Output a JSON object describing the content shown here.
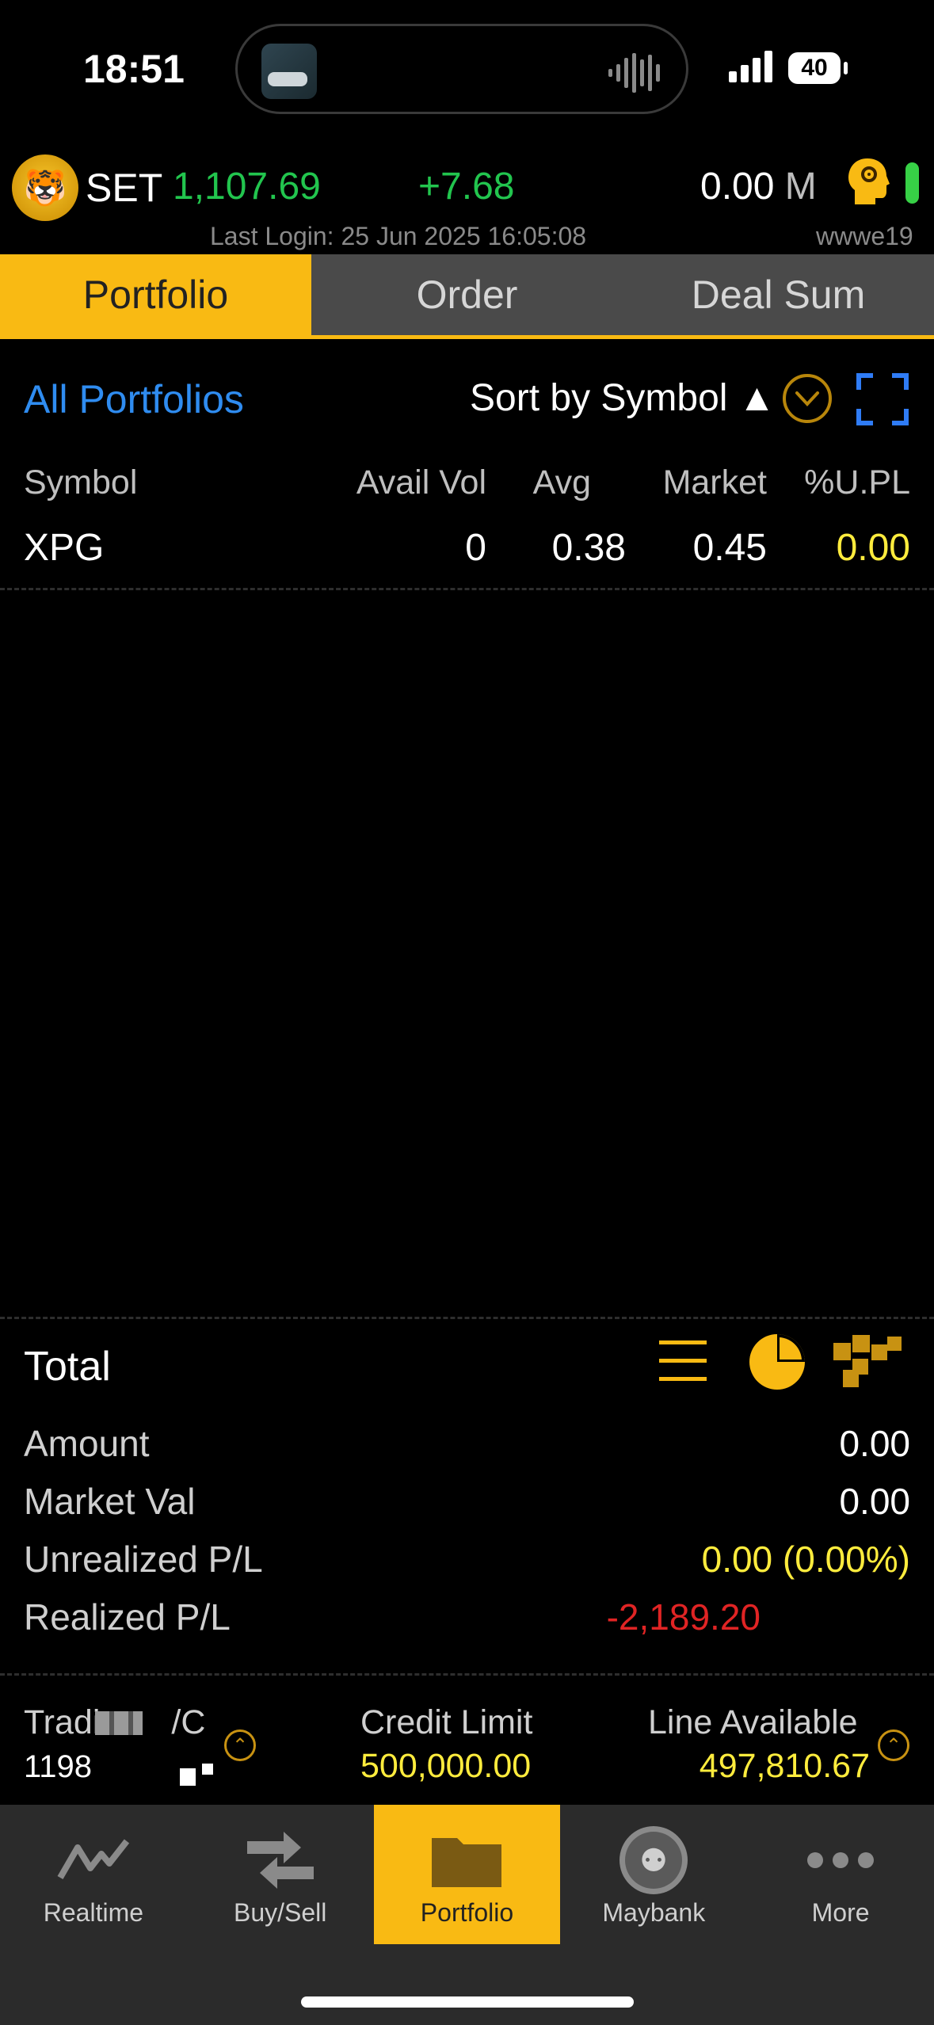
{
  "status_bar": {
    "time": "18:51",
    "battery": "40"
  },
  "market": {
    "name": "SET",
    "index": "1,107.69",
    "change": "+7.68",
    "volume": "0.00",
    "volume_unit": "M",
    "last_login": "Last Login: 25 Jun 2025 16:05:08",
    "user": "wwwe19"
  },
  "tabs": [
    {
      "label": "Portfolio",
      "active": true
    },
    {
      "label": "Order",
      "active": false
    },
    {
      "label": "Deal Sum",
      "active": false
    }
  ],
  "portfolio_bar": {
    "selector": "All Portfolios",
    "sort": "Sort by Symbol ▲"
  },
  "table": {
    "headers": [
      "Symbol",
      "Avail Vol",
      "Avg",
      "Market",
      "%U.PL"
    ],
    "rows": [
      {
        "symbol": "XPG",
        "avail_vol": "0",
        "avg": "0.38",
        "market": "0.45",
        "upl": "0.00"
      }
    ]
  },
  "totals": {
    "title": "Total",
    "rows": [
      {
        "label": "Amount",
        "value": "0.00"
      },
      {
        "label": "Market Val",
        "value": "0.00"
      },
      {
        "label": "Unrealized P/L",
        "value": "0.00 (0.00%)"
      },
      {
        "label": "Realized P/L",
        "value": "-2,189.20"
      }
    ]
  },
  "account": {
    "label_partial": "Tradi",
    "label_end": "/C",
    "number_partial": "11986",
    "credit_limit_label": "Credit Limit",
    "credit_limit": "500,000.00",
    "line_available_label": "Line Available",
    "line_available": "497,810.67"
  },
  "nav": [
    {
      "label": "Realtime",
      "icon": "chart-line-icon"
    },
    {
      "label": "Buy/Sell",
      "icon": "swap-arrows-icon"
    },
    {
      "label": "Portfolio",
      "icon": "folder-icon",
      "active": true
    },
    {
      "label": "Maybank",
      "icon": "tiger-logo-icon"
    },
    {
      "label": "More",
      "icon": "more-dots-icon"
    }
  ],
  "colors": {
    "accent": "#f9ba13",
    "up": "#22c54e",
    "link": "#2f8cf0",
    "neutral_value": "#ffec3d",
    "negative": "#e02424"
  }
}
